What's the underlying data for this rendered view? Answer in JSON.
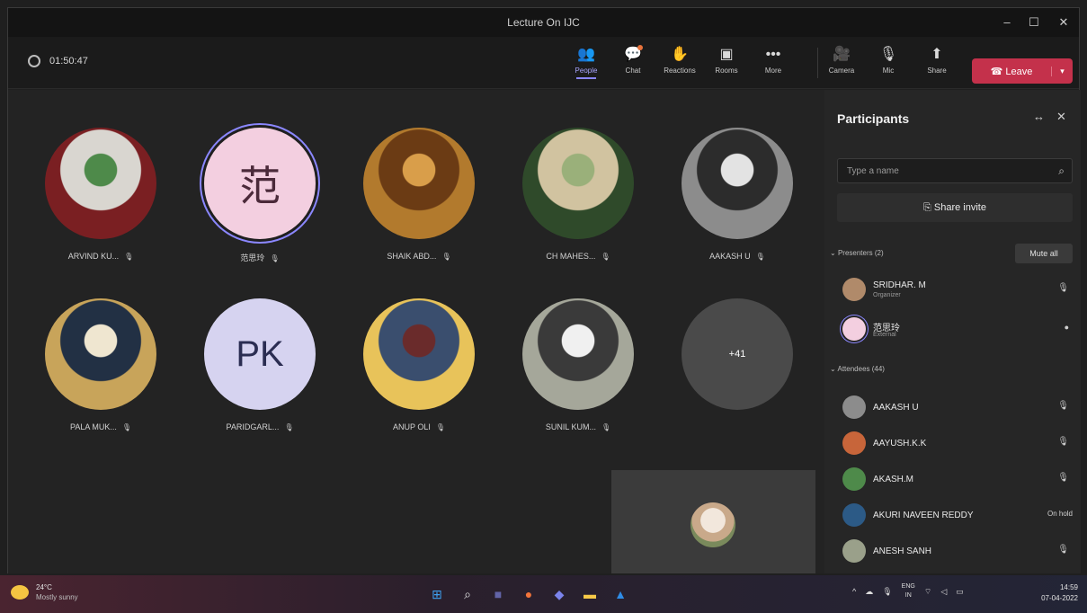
{
  "window": {
    "title": "Lecture On IJC",
    "controls": [
      "–",
      "☐",
      "✕"
    ]
  },
  "toolbar": {
    "timer": "01:50:47",
    "buttons": [
      {
        "label": "People",
        "icon": "people-icon",
        "glyph": "👥"
      },
      {
        "label": "Chat",
        "icon": "chat-icon",
        "glyph": "💬"
      },
      {
        "label": "Reactions",
        "icon": "reactions-icon",
        "glyph": "✋"
      },
      {
        "label": "Rooms",
        "icon": "rooms-icon",
        "glyph": "▣"
      },
      {
        "label": "More",
        "icon": "more-icon",
        "glyph": "•••"
      },
      {
        "label": "Camera",
        "icon": "camera-icon",
        "glyph": "🎥"
      },
      {
        "label": "Mic",
        "icon": "mic-icon",
        "glyph": "🎙"
      },
      {
        "label": "Share",
        "icon": "share-icon",
        "glyph": "⬆"
      }
    ],
    "leave_label": "Leave",
    "leave_glyph": "☎",
    "accent": "#c4314b"
  },
  "gallery": {
    "tiles": [
      {
        "name": "ARVIND KU...",
        "kind": "photo",
        "colors": [
          "#7a1f22",
          "#4e8a4a",
          "#d9d6d0"
        ]
      },
      {
        "name": "范思玲",
        "kind": "initial",
        "initial": "范",
        "bg": "#f3cfe0",
        "fg": "#4b2a3a"
      },
      {
        "name": "SHAIK ABD...",
        "kind": "photo",
        "colors": [
          "#b27a2d",
          "#d99e4a",
          "#6b3b14"
        ]
      },
      {
        "name": "CH MAHES...",
        "kind": "photo",
        "colors": [
          "#2f4a2a",
          "#9ab07a",
          "#d1c3a0"
        ]
      },
      {
        "name": "AAKASH U",
        "kind": "photo",
        "colors": [
          "#8c8c8c",
          "#e3e3e3",
          "#2c2c2c"
        ]
      },
      {
        "name": "PALA MUK...",
        "kind": "photo",
        "colors": [
          "#c8a45a",
          "#efe6d0",
          "#223044"
        ]
      },
      {
        "name": "PARIDGARL...",
        "kind": "initial",
        "initial": "PK",
        "bg": "#d6d3f0",
        "fg": "#2b2d52"
      },
      {
        "name": "ANUP OLI",
        "kind": "photo",
        "colors": [
          "#e8c35a",
          "#6a2b2b",
          "#3a4e6e"
        ]
      },
      {
        "name": "SUNIL KUM...",
        "kind": "photo",
        "colors": [
          "#a5a79a",
          "#f0f0f0",
          "#3a3a3a"
        ]
      },
      {
        "name": "",
        "kind": "overflow",
        "initial": "+41",
        "bg": "#4a4a4a",
        "fg": "#ffffff"
      }
    ],
    "mic_glyph": "🎙"
  },
  "panel": {
    "title": "Participants",
    "search_placeholder": "Type a name",
    "share_invite": "Share invite",
    "presenters_header": "Presenters (2)",
    "mute_all": "Mute all",
    "attendees_header": "Attendees (44)",
    "presenters": [
      {
        "name": "SRIDHAR. M",
        "role": "Organizer",
        "status": "mic-off",
        "color": "#b08a6a"
      },
      {
        "name": "范思玲",
        "role": "External",
        "status": "mic-on",
        "color": "#f3cfe0"
      }
    ],
    "attendees": [
      {
        "name": "AAKASH U",
        "status": "mic-off",
        "color": "#8c8c8c"
      },
      {
        "name": "AAYUSH.K.K",
        "status": "mic-off",
        "color": "#c7653a"
      },
      {
        "name": "AKASH.M",
        "status": "mic-off",
        "color": "#4e8a4a"
      },
      {
        "name": "AKURI NAVEEN REDDY",
        "status": "on-hold",
        "hold_label": "On hold",
        "color": "#2c5a86"
      },
      {
        "name": "ANESH SANH",
        "status": "mic-off",
        "color": "#9aa08a"
      }
    ]
  },
  "taskbar": {
    "weather_temp": "24°C",
    "weather_text": "Mostly sunny",
    "apps": [
      {
        "name": "windows-start-icon",
        "glyph": "⊞",
        "color": "#3ea0f0"
      },
      {
        "name": "search-icon",
        "glyph": "⌕",
        "color": "#e5e5e5"
      },
      {
        "name": "teams-chat-icon",
        "glyph": "■",
        "color": "#6264a7"
      },
      {
        "name": "firefox-icon",
        "glyph": "●",
        "color": "#f2743a"
      },
      {
        "name": "teams-icon",
        "glyph": "◆",
        "color": "#7b83eb"
      },
      {
        "name": "file-explorer-icon",
        "glyph": "▬",
        "color": "#f7c948"
      },
      {
        "name": "store-icon",
        "glyph": "▲",
        "color": "#2f8ce6"
      }
    ],
    "lang_line1": "ENG",
    "lang_line2": "IN",
    "time": "14:59",
    "date": "07-04-2022"
  }
}
